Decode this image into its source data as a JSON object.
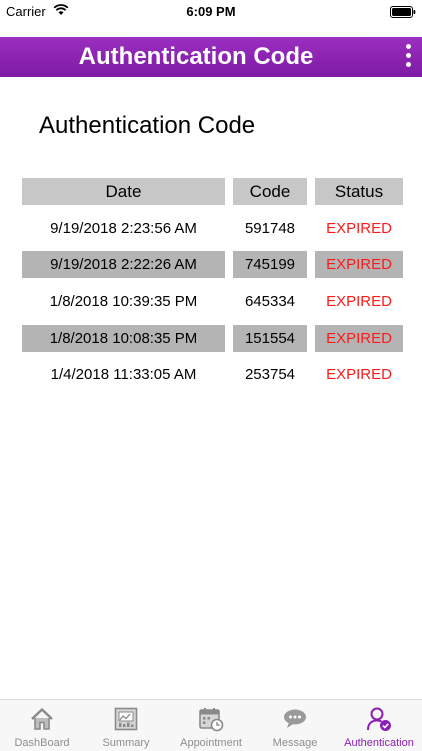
{
  "status_bar": {
    "carrier": "Carrier",
    "time": "6:09 PM"
  },
  "navbar": {
    "title": "Authentication Code"
  },
  "page": {
    "heading": "Authentication Code"
  },
  "table": {
    "headers": {
      "date": "Date",
      "code": "Code",
      "status": "Status"
    },
    "rows": [
      {
        "date": "9/19/2018 2:23:56 AM",
        "code": "591748",
        "status": "EXPIRED"
      },
      {
        "date": "9/19/2018 2:22:26 AM",
        "code": "745199",
        "status": "EXPIRED"
      },
      {
        "date": "1/8/2018 10:39:35 PM",
        "code": "645334",
        "status": "EXPIRED"
      },
      {
        "date": "1/8/2018 10:08:35 PM",
        "code": "151554",
        "status": "EXPIRED"
      },
      {
        "date": "1/4/2018 11:33:05 AM",
        "code": "253754",
        "status": "EXPIRED"
      }
    ]
  },
  "tabs": [
    {
      "label": "DashBoard",
      "icon": "house-icon"
    },
    {
      "label": "Summary",
      "icon": "chart-report-icon"
    },
    {
      "label": "Appointment",
      "icon": "calendar-clock-icon"
    },
    {
      "label": "Message",
      "icon": "chat-bubble-icon"
    },
    {
      "label": "Authentication",
      "icon": "user-check-icon",
      "active": true
    }
  ],
  "colors": {
    "nav_purple": "#8a1fb4",
    "expired_red": "#ff1a1a",
    "header_gray": "#c7c7c7",
    "row_gray": "#b4b4b4"
  }
}
